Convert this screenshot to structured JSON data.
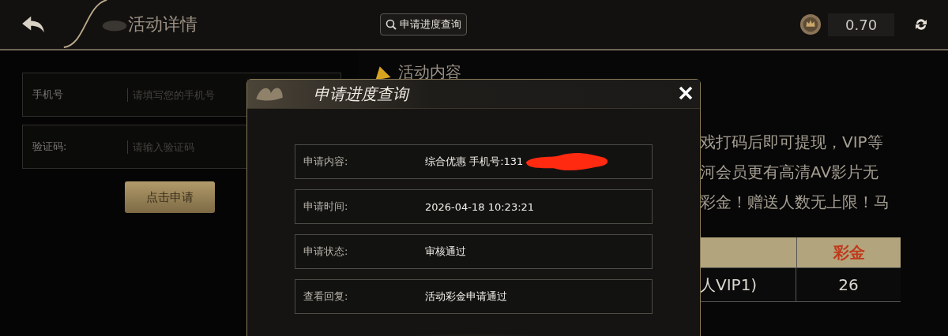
{
  "header": {
    "title": "活动详情",
    "query_button": "申请进度查询",
    "balance": "0.70"
  },
  "form": {
    "fields": [
      {
        "label": "手机号",
        "placeholder": "请填写您的手机号"
      },
      {
        "label": "验证码:",
        "placeholder": "请输入验证码"
      }
    ],
    "submit": "点击申请"
  },
  "content": {
    "heading": "活动内容",
    "lines": [
      "戏打码后即可提现，VIP等",
      "河会员更有高清AV影片无",
      "彩金！赠送人数无上限！马"
    ],
    "table": {
      "header": "彩金",
      "rows": [
        {
          "column_1": "人VIP1)",
          "column_2": "26"
        }
      ]
    }
  },
  "dialog": {
    "title": "申请进度查询",
    "rows": [
      {
        "label": "申请内容:",
        "value": "综合优惠 手机号:131",
        "redacted": true
      },
      {
        "label": "申请时间:",
        "value": "2026-04-18 10:23:21",
        "redacted": false
      },
      {
        "label": "申请状态:",
        "value": "审核通过",
        "redacted": false
      },
      {
        "label": "查看回复:",
        "value": "活动彩金申请通过",
        "redacted": false
      }
    ]
  }
}
